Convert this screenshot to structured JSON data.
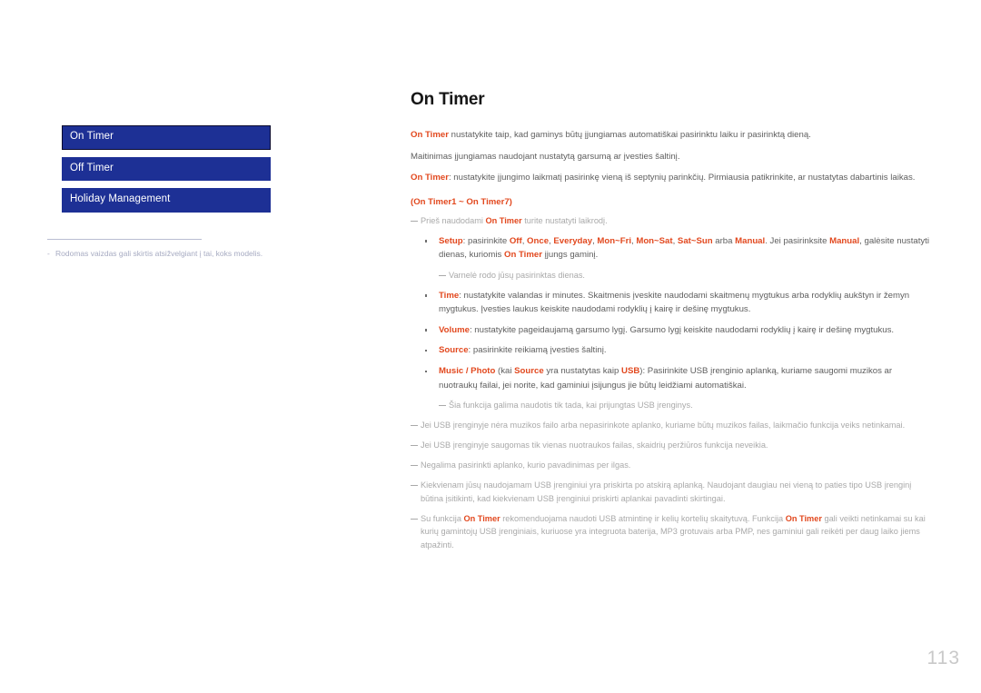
{
  "page": {
    "title": "On Timer",
    "number": "113"
  },
  "sidebar": {
    "items": [
      {
        "label": "On Timer",
        "selected": true
      },
      {
        "label": "Off Timer",
        "selected": false
      },
      {
        "label": "Holiday Management",
        "selected": false
      }
    ],
    "note": "Rodomas vaizdas gali skirtis atsižvelgiant į tai, koks modelis.",
    "note_marker": "-"
  },
  "content": {
    "intro": {
      "lead": "On Timer",
      "text": " nustatykite taip, kad gaminys būtų įjungiamas automatiškai pasirinktu laiku ir pasirinktą dieną."
    },
    "power_note": "Maitinimas įjungiamas naudojant nustatytą garsumą ar įvesties šaltinį.",
    "setup_intro": {
      "lead": "On Timer",
      "text": ": nustatykite įjungimo laikmatį pasirinkę vieną iš septynių parinkčių. Pirmiausia patikrinkite, ar nustatytas dabartinis laikas."
    },
    "section_label": "(On Timer1 ~ On Timer7)",
    "clock_note_pre": "Prieš naudodami ",
    "clock_note_hl": "On Timer",
    "clock_note_post": " turite nustatyti laikrodį.",
    "bullets": [
      {
        "name": "setup",
        "label": "Setup",
        "text_segments": [
          {
            "t": ": pasirinkite ",
            "hl": false
          },
          {
            "t": "Off",
            "hl": true
          },
          {
            "t": ", ",
            "hl": false
          },
          {
            "t": "Once",
            "hl": true
          },
          {
            "t": ", ",
            "hl": false
          },
          {
            "t": "Everyday",
            "hl": true
          },
          {
            "t": ", ",
            "hl": false
          },
          {
            "t": "Mon~Fri",
            "hl": true
          },
          {
            "t": ", ",
            "hl": false
          },
          {
            "t": "Mon~Sat",
            "hl": true
          },
          {
            "t": ", ",
            "hl": false
          },
          {
            "t": "Sat~Sun",
            "hl": true
          },
          {
            "t": " arba ",
            "hl": false
          },
          {
            "t": "Manual",
            "hl": true
          },
          {
            "t": ". Jei pasirinksite ",
            "hl": false
          },
          {
            "t": "Manual",
            "hl": true
          },
          {
            "t": ", galėsite nustatyti dienas, kuriomis ",
            "hl": false
          },
          {
            "t": "On Timer",
            "hl": true
          },
          {
            "t": " įjungs gaminį.",
            "hl": false
          }
        ]
      },
      {
        "name": "time",
        "label": "Time",
        "text_segments": [
          {
            "t": ": nustatykite valandas ir minutes. Skaitmenis įveskite naudodami skaitmenų mygtukus arba rodyklių aukštyn ir žemyn mygtukus. Įvesties laukus keiskite naudodami rodyklių į kairę ir dešinę mygtukus.",
            "hl": false
          }
        ]
      },
      {
        "name": "volume",
        "label": "Volume",
        "text_segments": [
          {
            "t": ": nustatykite pageidaujamą garsumo lygį. Garsumo lygį keiskite naudodami rodyklių į kairę ir dešinę mygtukus.",
            "hl": false
          }
        ]
      },
      {
        "name": "source",
        "label": "Source",
        "text_segments": [
          {
            "t": ": pasirinkite reikiamą įvesties šaltinį.",
            "hl": false
          }
        ]
      },
      {
        "name": "music-photo",
        "label": "Music / Photo",
        "text_segments": [
          {
            "t": " (kai ",
            "hl": false
          },
          {
            "t": "Source",
            "hl": true
          },
          {
            "t": " yra nustatytas kaip ",
            "hl": false
          },
          {
            "t": "USB",
            "hl": true
          },
          {
            "t": "): Pasirinkite USB įrenginio aplanką, kuriame saugomi muzikos ar nuotraukų failai, jei norite, kad gaminiui įsijungus jie būtų leidžiami automatiškai.",
            "hl": false
          }
        ]
      }
    ],
    "setup_sub_note": "Varnelė rodo jūsų pasirinktas dienas.",
    "usb_sub_note": "Šia funkcija galima naudotis tik tada, kai prijungtas USB įrenginys.",
    "notes": [
      {
        "text": "Jei USB įrenginyje nėra muzikos failo arba nepasirinkote aplanko, kuriame būtų muzikos failas, laikmačio funkcija veiks netinkamai."
      },
      {
        "text": "Jei USB įrenginyje saugomas tik vienas nuotraukos failas, skaidrių peržiūros funkcija neveikia."
      },
      {
        "text": "Negalima pasirinkti aplanko, kurio pavadinimas per ilgas."
      },
      {
        "text": "Kiekvienam jūsų naudojamam USB įrenginiui yra priskirta po atskirą aplanką. Naudojant daugiau nei vieną to paties tipo USB įrenginį būtina įsitikinti, kad kiekvienam USB įrenginiui priskirti aplankai pavadinti skirtingai."
      }
    ],
    "final_note": {
      "pre": "Su funkcija ",
      "hl1": "On Timer",
      "mid": " rekomenduojama naudoti USB atmintinę ir kelių kortelių skaitytuvą. Funkcija ",
      "hl2": "On Timer",
      "post": " gali veikti netinkamai su kai kurių gamintojų USB įrenginiais, kuriuose yra integruota baterija, MP3 grotuvais arba PMP, nes gaminiui gali reikėti per daug laiko jiems atpažinti."
    }
  },
  "colors": {
    "accent": "#e2481e",
    "menu_blue": "#1d3095",
    "body_text": "#5e5e5e",
    "note_text": "#a9a9a9"
  }
}
